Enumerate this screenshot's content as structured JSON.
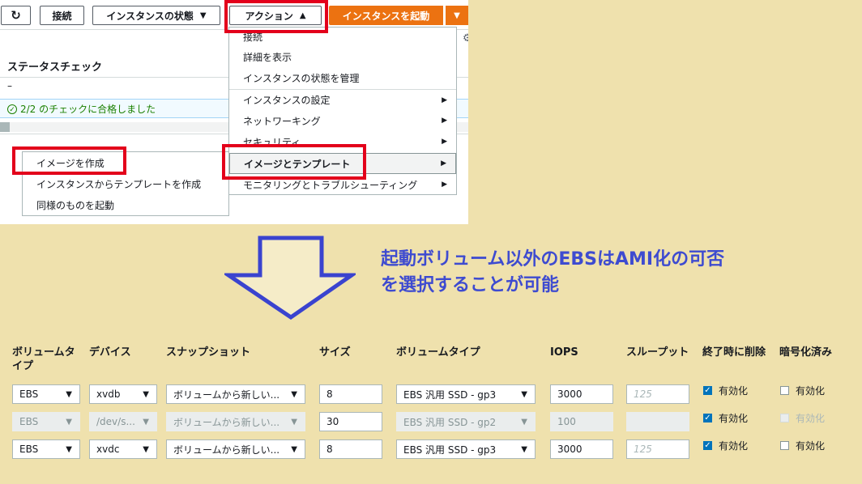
{
  "toolbar": {
    "connect": "接続",
    "instance_state": "インスタンスの状態",
    "actions": "アクション",
    "launch_instance": "インスタンスを起動"
  },
  "status_panel": {
    "column_header": "ステータスチェック",
    "dash": "–",
    "check_result": "2/2 のチェックに合格しました"
  },
  "actions_menu": {
    "items": [
      {
        "label": "接続",
        "submenu": false
      },
      {
        "label": "詳細を表示",
        "submenu": false
      },
      {
        "label": "インスタンスの状態を管理",
        "submenu": false
      },
      {
        "label": "インスタンスの設定",
        "submenu": true
      },
      {
        "label": "ネットワーキング",
        "submenu": true
      },
      {
        "label": "セキュリティ",
        "submenu": true
      },
      {
        "label": "イメージとテンプレート",
        "submenu": true
      },
      {
        "label": "モニタリングとトラブルシューティング",
        "submenu": true
      }
    ]
  },
  "image_submenu": {
    "items": [
      {
        "label": "イメージを作成"
      },
      {
        "label": "インスタンスからテンプレートを作成"
      },
      {
        "label": "同様のものを起動"
      }
    ]
  },
  "annotation": {
    "line1": "起動ボリューム以外のEBSはAMI化の可否",
    "line2": "を選択することが可能"
  },
  "volumes": {
    "headers": {
      "volume_type": "ボリュームタイプ",
      "device": "デバイス",
      "snapshot": "スナップショット",
      "size": "サイズ",
      "ebs_type": "ボリュームタイプ",
      "iops": "IOPS",
      "throughput": "スループット",
      "delete_on_termination": "終了時に削除",
      "encrypted": "暗号化済み"
    },
    "rows": [
      {
        "type": "EBS",
        "device": "xvdb",
        "snapshot": "ボリュームから新しい...",
        "size": "8",
        "ebs_type": "EBS 汎用 SSD - gp3",
        "iops": "3000",
        "throughput": "125",
        "delete_label": "有効化",
        "encrypt_label": "有効化"
      },
      {
        "type": "EBS",
        "device": "/dev/s...",
        "snapshot": "ボリュームから新しい...",
        "size": "30",
        "ebs_type": "EBS 汎用 SSD - gp2",
        "iops": "100",
        "throughput": "",
        "delete_label": "有効化",
        "encrypt_label": "有効化"
      },
      {
        "type": "EBS",
        "device": "xvdc",
        "snapshot": "ボリュームから新しい...",
        "size": "8",
        "ebs_type": "EBS 汎用 SSD - gp3",
        "iops": "3000",
        "throughput": "125",
        "delete_label": "有効化",
        "encrypt_label": "有効化"
      }
    ]
  },
  "colors": {
    "background": "#efe1ad",
    "primary_orange": "#ec7211",
    "highlight_red": "#e3001b",
    "annotation_blue": "#3e4bd0",
    "success_green": "#1d8102",
    "checkbox_blue": "#0073bb"
  }
}
